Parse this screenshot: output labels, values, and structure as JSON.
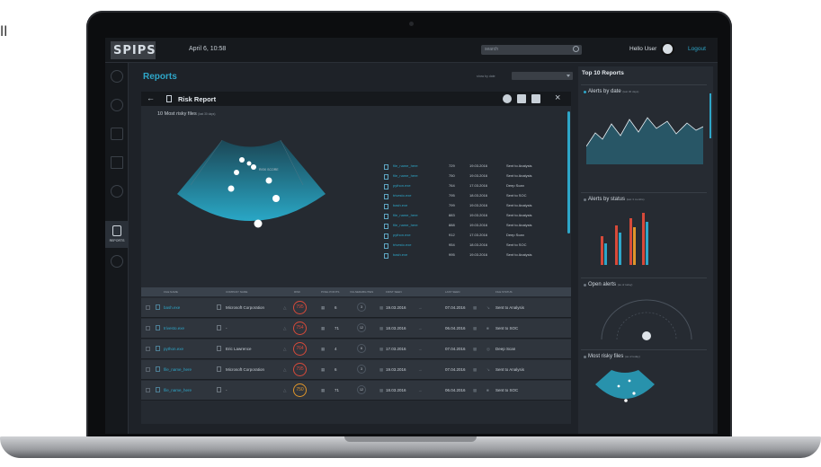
{
  "edge_fragment": "ll",
  "app": {
    "logo": "SPIPS",
    "datetime": "April 6, 10:58",
    "search_placeholder": "search",
    "greeting": "Hello User",
    "logout": "Logout"
  },
  "sidebar": {
    "active_label": "REPORTS"
  },
  "page": {
    "title": "Reports",
    "sort_label": "show by date"
  },
  "report": {
    "title": "Risk Report",
    "section_title": "10 Most risky files",
    "section_note": "(last 30 days)",
    "gauge_label": "RISK SCORE",
    "files": [
      {
        "name": "file_name_here",
        "score": "729",
        "date": "19.03.2016",
        "status": "Sent to Analysis"
      },
      {
        "name": "file_name_here",
        "score": "750",
        "date": "19.03.2016",
        "status": "Sent to Analysis"
      },
      {
        "name": "python.exe",
        "score": "764",
        "date": "17.03.2016",
        "status": "Deep Scan"
      },
      {
        "name": "trivesto.exe",
        "score": "795",
        "date": "18.03.2016",
        "status": "Sent to SOC"
      },
      {
        "name": "bash.exe",
        "score": "799",
        "date": "19.03.2016",
        "status": "Sent to Analysis"
      },
      {
        "name": "file_name_here",
        "score": "883",
        "date": "19.03.2016",
        "status": "Sent to Analysis"
      },
      {
        "name": "file_name_here",
        "score": "888",
        "date": "19.03.2016",
        "status": "Sent to Analysis"
      },
      {
        "name": "python.exe",
        "score": "912",
        "date": "17.03.2016",
        "status": "Deep Scan"
      },
      {
        "name": "trivesto.exe",
        "score": "954",
        "date": "18.03.2016",
        "status": "Sent to SOC"
      },
      {
        "name": "bash.exe",
        "score": "995",
        "date": "19.03.2016",
        "status": "Sent to Analysis"
      }
    ],
    "columns": [
      "FILE NAME",
      "COMPANY NAME",
      "RISK",
      "PIXEL POINTS",
      "VULNERABILITIES",
      "FIRST SEEN",
      "LAST SEEN",
      "FILE STATUS"
    ],
    "rows": [
      {
        "file": "bash.exe",
        "company": "Microsoft Corporation",
        "risk": "795",
        "points": "6",
        "vuln": "3",
        "first": "19.03.2016",
        "last": "07.04.2016",
        "status": "Sent to Analysis"
      },
      {
        "file": "trivesto.exe",
        "company": "-",
        "risk": "754",
        "points": "71",
        "vuln": "12",
        "first": "18.03.2016",
        "last": "06.04.2016",
        "status": "Sent to SOC"
      },
      {
        "file": "python.exe",
        "company": "Eric Lawrence",
        "risk": "764",
        "points": "4",
        "vuln": "6",
        "first": "17.03.2016",
        "last": "07.04.2016",
        "status": "Deep Scan"
      },
      {
        "file": "file_name_here",
        "company": "Microsoft Corporation",
        "risk": "795",
        "points": "6",
        "vuln": "3",
        "first": "19.03.2016",
        "last": "07.04.2016",
        "status": "Sent to Analysis"
      },
      {
        "file": "file_name_here",
        "company": "-",
        "risk": "750",
        "points": "71",
        "vuln": "12",
        "first": "18.03.2016",
        "last": "06.04.2016",
        "status": "Sent to SOC"
      }
    ]
  },
  "right_panel": {
    "title": "Top 10 Reports",
    "sections": [
      {
        "title": "Alerts by date",
        "note": "(last 30 days)"
      },
      {
        "title": "Alerts by status",
        "note": "(last 3 months)"
      },
      {
        "title": "Open alerts",
        "note": "(as of today)"
      },
      {
        "title": "Most risky files",
        "note": "(as of today)"
      }
    ]
  },
  "colors": {
    "accent": "#2ea6c8",
    "risk_high": "#d74a3a",
    "risk_mid": "#e0962a",
    "screen_bg": "#1e2228"
  }
}
